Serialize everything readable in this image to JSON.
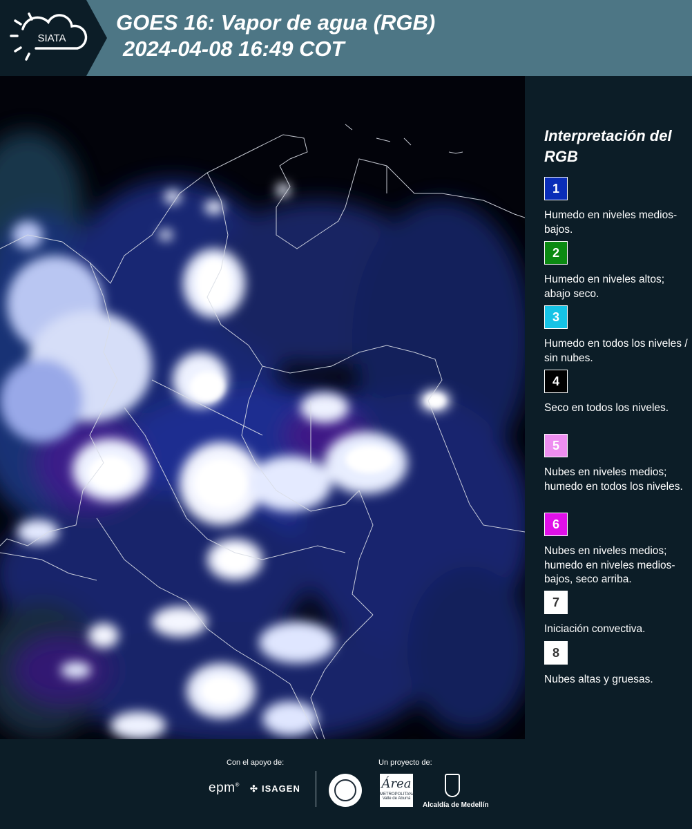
{
  "header": {
    "logo_text": "SIATA",
    "title_line1": "GOES 16: Vapor de agua (RGB)",
    "title_line2": "2024-04-08 16:49 COT"
  },
  "legend": {
    "title": "Interpretación del RGB",
    "items": [
      {
        "number": "1",
        "color": "#0a2db8",
        "text": "Humedo en niveles medios-bajos."
      },
      {
        "number": "2",
        "color": "#0b8a12",
        "text": "Humedo en niveles altos; abajo seco."
      },
      {
        "number": "3",
        "color": "#16c3e6",
        "text": "Humedo en todos los niveles / sin nubes."
      },
      {
        "number": "4",
        "color": "#000000",
        "text": "Seco en todos los niveles."
      },
      {
        "number": "5",
        "color": "#ee8ef0",
        "text": "Nubes en niveles medios; humedo en todos los niveles."
      },
      {
        "number": "6",
        "color": "#e010e8",
        "text": "Nubes en niveles medios; humedo en niveles medios-bajos, seco arriba."
      },
      {
        "number": "7",
        "color": "#ffffff",
        "text": "Iniciación convectiva."
      },
      {
        "number": "8",
        "color": "#ffffff",
        "text": "Nubes altas y gruesas."
      }
    ]
  },
  "footer": {
    "support_label": "Con el apoyo de:",
    "project_label": "Un proyecto de:",
    "epm": "epm",
    "isagen": "ISAGEN",
    "amva_script": "Área",
    "amva_sub": "METROPOLITANA",
    "amva_subsub": "Valle de Aburrá",
    "alcaldia": "Alcaldía de Medellín"
  }
}
